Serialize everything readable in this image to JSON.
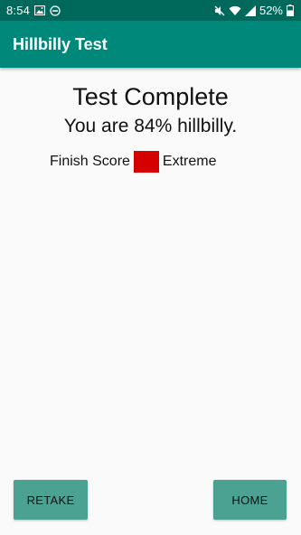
{
  "status_bar": {
    "time": "8:54",
    "battery": "52%",
    "left_icons": [
      "image-icon",
      "do-not-disturb-icon"
    ],
    "right_icons": [
      "mute-icon",
      "wifi-icon",
      "signal-icon",
      "battery-icon"
    ]
  },
  "app_bar": {
    "title": "Hillbilly Test"
  },
  "result": {
    "heading": "Test Complete",
    "summary": "You are 84% hillbilly.",
    "score_label": "Finish Score",
    "level": "Extreme",
    "level_color": "#d50000"
  },
  "actions": {
    "retake_label": "RETAKE",
    "home_label": "HOME"
  },
  "colors": {
    "status_bar": "#00695c",
    "app_bar": "#00897b",
    "button": "#4ba293"
  }
}
